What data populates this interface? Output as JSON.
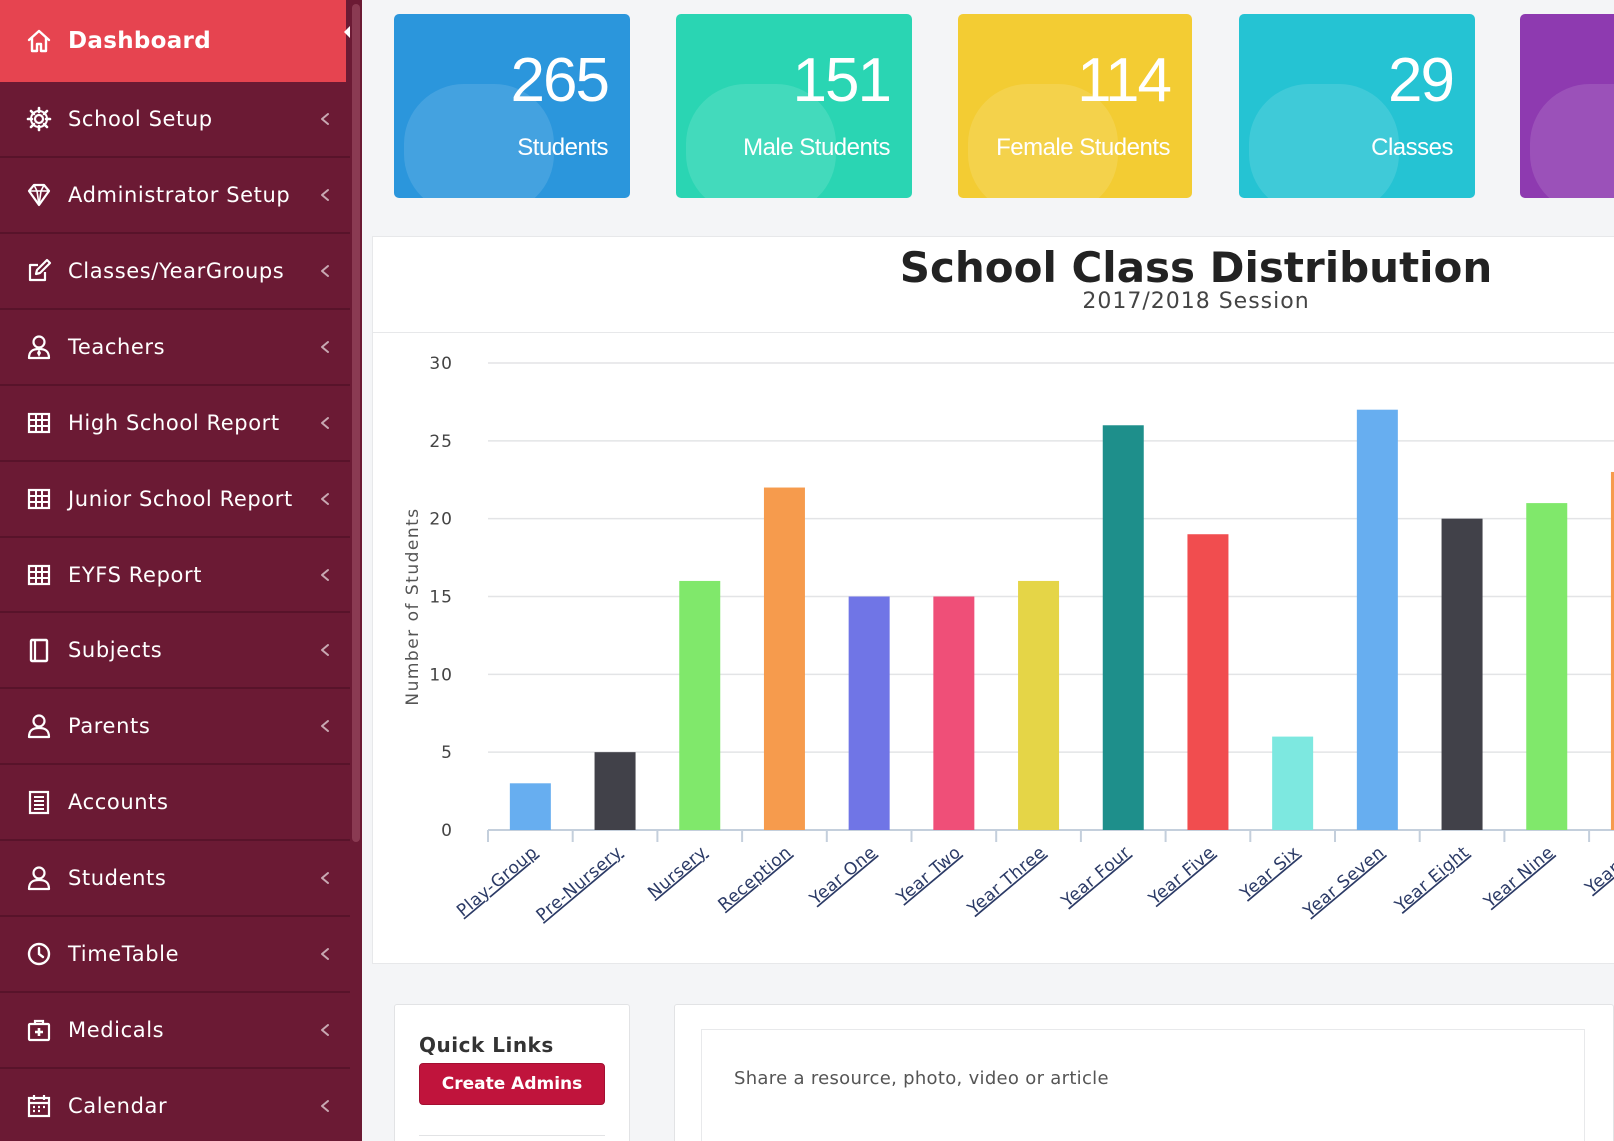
{
  "sidebar": {
    "items": [
      {
        "label": "Dashboard",
        "icon": "home-icon",
        "name": "sidebar-item-dashboard",
        "active": true,
        "chevron": false
      },
      {
        "label": "School Setup",
        "icon": "gear-icon",
        "name": "sidebar-item-school-setup",
        "active": false,
        "chevron": true
      },
      {
        "label": "Administrator Setup",
        "icon": "diamond-icon",
        "name": "sidebar-item-administrator-setup",
        "active": false,
        "chevron": true
      },
      {
        "label": "Classes/YearGroups",
        "icon": "edit-icon",
        "name": "sidebar-item-classes-yeargroups",
        "active": false,
        "chevron": true
      },
      {
        "label": "Teachers",
        "icon": "user-tie-icon",
        "name": "sidebar-item-teachers",
        "active": false,
        "chevron": true
      },
      {
        "label": "High School Report",
        "icon": "table-icon",
        "name": "sidebar-item-high-school-report",
        "active": false,
        "chevron": true
      },
      {
        "label": "Junior School Report",
        "icon": "table-icon",
        "name": "sidebar-item-junior-school-report",
        "active": false,
        "chevron": true
      },
      {
        "label": "EYFS Report",
        "icon": "table-icon",
        "name": "sidebar-item-eyfs-report",
        "active": false,
        "chevron": true
      },
      {
        "label": "Subjects",
        "icon": "book-icon",
        "name": "sidebar-item-subjects",
        "active": false,
        "chevron": true
      },
      {
        "label": "Parents",
        "icon": "user-icon",
        "name": "sidebar-item-parents",
        "active": false,
        "chevron": true
      },
      {
        "label": "Accounts",
        "icon": "ledger-icon",
        "name": "sidebar-item-accounts",
        "active": false,
        "chevron": false
      },
      {
        "label": "Students",
        "icon": "user-icon",
        "name": "sidebar-item-students",
        "active": false,
        "chevron": true
      },
      {
        "label": "TimeTable",
        "icon": "clock-icon",
        "name": "sidebar-item-timetable",
        "active": false,
        "chevron": true
      },
      {
        "label": "Medicals",
        "icon": "first-aid-icon",
        "name": "sidebar-item-medicals",
        "active": false,
        "chevron": true
      },
      {
        "label": "Calendar",
        "icon": "calendar-icon",
        "name": "sidebar-item-calendar",
        "active": false,
        "chevron": true
      }
    ]
  },
  "stats": [
    {
      "value": "265",
      "label": "Students",
      "color": "#2b96dc",
      "name": "stat-card-students"
    },
    {
      "value": "151",
      "label": "Male Students",
      "color": "#2ad5b3",
      "name": "stat-card-male-students"
    },
    {
      "value": "114",
      "label": "Female Students",
      "color": "#f3cc33",
      "name": "stat-card-female-students"
    },
    {
      "value": "29",
      "label": "Classes",
      "color": "#25c3d3",
      "name": "stat-card-classes"
    },
    {
      "value": "",
      "label": "",
      "color": "#8e3ab0",
      "name": "stat-card-extra"
    }
  ],
  "chart": {
    "title": "School Class Distribution",
    "subtitle": "2017/2018 Session"
  },
  "chart_data": {
    "type": "bar",
    "title": "School Class Distribution",
    "subtitle": "2017/2018 Session",
    "ylabel": "Number of Students",
    "xlabel": "",
    "ylim": [
      0,
      30
    ],
    "yticks": [
      0,
      5,
      10,
      15,
      20,
      25,
      30
    ],
    "grid": true,
    "categories": [
      "Play-Group",
      "Pre-Nursery",
      "Nursery",
      "Reception",
      "Year One",
      "Year Two",
      "Year Three",
      "Year Four",
      "Year Five",
      "Year Six",
      "Year Seven",
      "Year Eight",
      "Year Nine",
      "Year Te"
    ],
    "values": [
      3,
      5,
      16,
      22,
      15,
      15,
      16,
      26,
      19,
      6,
      27,
      20,
      21,
      23
    ],
    "colors": [
      "#67aef0",
      "#414149",
      "#80e86b",
      "#f69b4d",
      "#7075e6",
      "#ef4f78",
      "#e5d547",
      "#1e8f8b",
      "#f14d4f",
      "#7de8e0",
      "#67aef0",
      "#414149",
      "#80e86b",
      "#f69b4d"
    ]
  },
  "quick_links": {
    "title": "Quick Links",
    "create_admins": "Create Admins"
  },
  "share": {
    "prompt": "Share a resource, photo, video or article"
  },
  "colors": {
    "sidebar_bg": "#6b1a34",
    "active_bg": "#e64450",
    "button_bg": "#c0143c"
  }
}
